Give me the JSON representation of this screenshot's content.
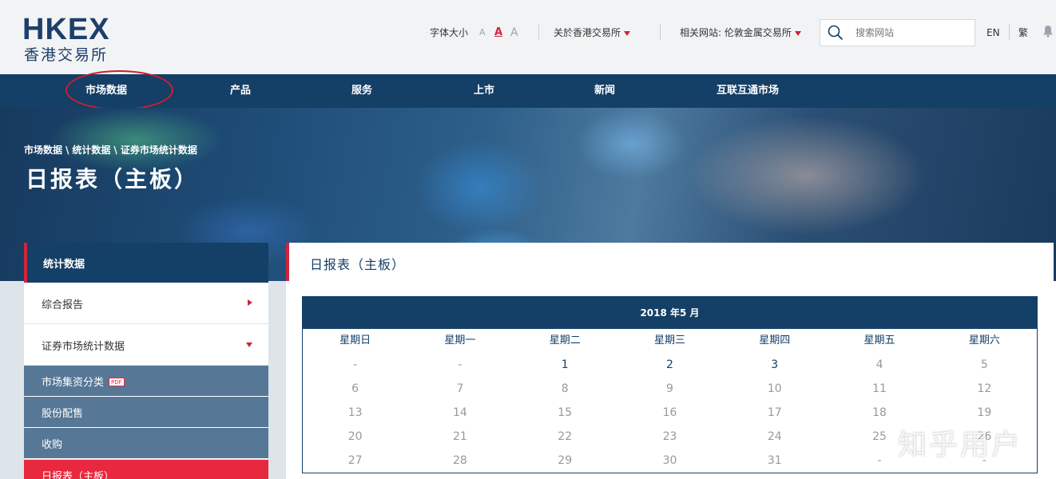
{
  "header": {
    "logo_en": "HKEX",
    "logo_cn": "香港交易所",
    "font_size_label": "字体大小",
    "font_sizes": [
      "A",
      "A",
      "A"
    ],
    "about_label": "关於香港交易所",
    "related_label": "相关网站: 伦敦金属交易所",
    "search_placeholder": "搜索网站",
    "lang_en": "EN",
    "lang_tc": "繁"
  },
  "nav": {
    "items": [
      "市场数据",
      "产品",
      "服务",
      "上市",
      "新闻",
      "互联互通市场"
    ]
  },
  "hero": {
    "breadcrumb": [
      "市场数据",
      "\\",
      "统计数据",
      "\\",
      "证券市场统计数据"
    ],
    "title": "日报表（主板）"
  },
  "sidebar": {
    "heading": "统计数据",
    "items": [
      "综合报告",
      "证券市场统计数据"
    ],
    "sub_items": [
      "市场集资分类",
      "股份配售",
      "收购",
      "日报表（主板）"
    ],
    "pdf_badge": "PDF"
  },
  "content": {
    "title": "日报表（主板）",
    "calendar": {
      "month_label": "2018 年5 月",
      "weekdays": [
        "星期日",
        "星期一",
        "星期二",
        "星期三",
        "星期四",
        "星期五",
        "星期六"
      ],
      "rows": [
        [
          "-",
          "-",
          "1",
          "2",
          "3",
          "4",
          "5"
        ],
        [
          "6",
          "7",
          "8",
          "9",
          "10",
          "11",
          "12"
        ],
        [
          "13",
          "14",
          "15",
          "16",
          "17",
          "18",
          "19"
        ],
        [
          "20",
          "21",
          "22",
          "23",
          "24",
          "25",
          "26"
        ],
        [
          "27",
          "28",
          "29",
          "30",
          "31",
          "-",
          "-"
        ]
      ],
      "linked_days": [
        "1",
        "2",
        "3"
      ]
    }
  },
  "watermark": "知乎用户",
  "colors": {
    "navy": "#143f66",
    "accent_red": "#d0243c",
    "sub_nav": "#577796"
  }
}
